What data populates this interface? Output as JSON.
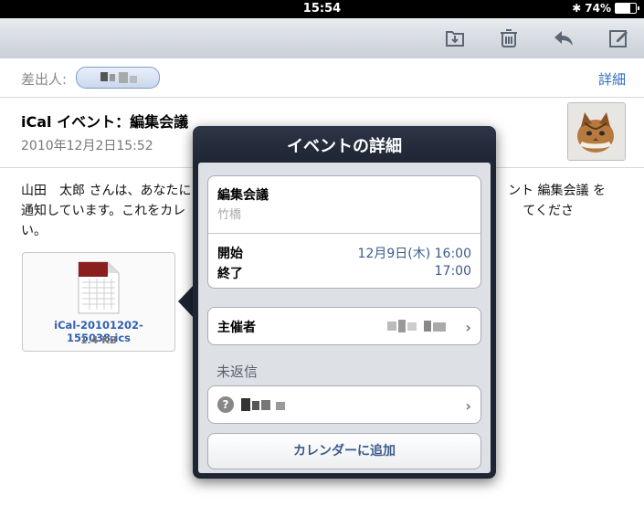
{
  "status": {
    "time": "15:54",
    "battery": "74%",
    "battery_level": 0.74
  },
  "toolbar": {
    "icons": [
      "move-folder-icon",
      "trash-icon",
      "reply-icon",
      "compose-icon"
    ]
  },
  "header": {
    "from_label": "差出人:",
    "details_label": "詳細"
  },
  "message": {
    "subject": "iCal イベント：編集会議",
    "date": "2010年12月2日15:52",
    "body_line1": "山田　太郎 さんは、あなたに",
    "body_line1_end": "ント 編集会議 を",
    "body_line2": "通知しています。これをカレ",
    "body_line2_end": "てくださ",
    "body_line3": "い。"
  },
  "attachment": {
    "filename": "iCal-20101202-155038.ics",
    "size": "1.4 KB"
  },
  "popover": {
    "title": "イベントの詳細",
    "event_title": "編集会議",
    "location": "竹橋",
    "start_label": "開始",
    "start_value": "12月9日(木)  16:00",
    "end_label": "終了",
    "end_value": "17:00",
    "organizer_label": "主催者",
    "pending_header": "未返信",
    "add_button": "カレンダーに追加"
  }
}
